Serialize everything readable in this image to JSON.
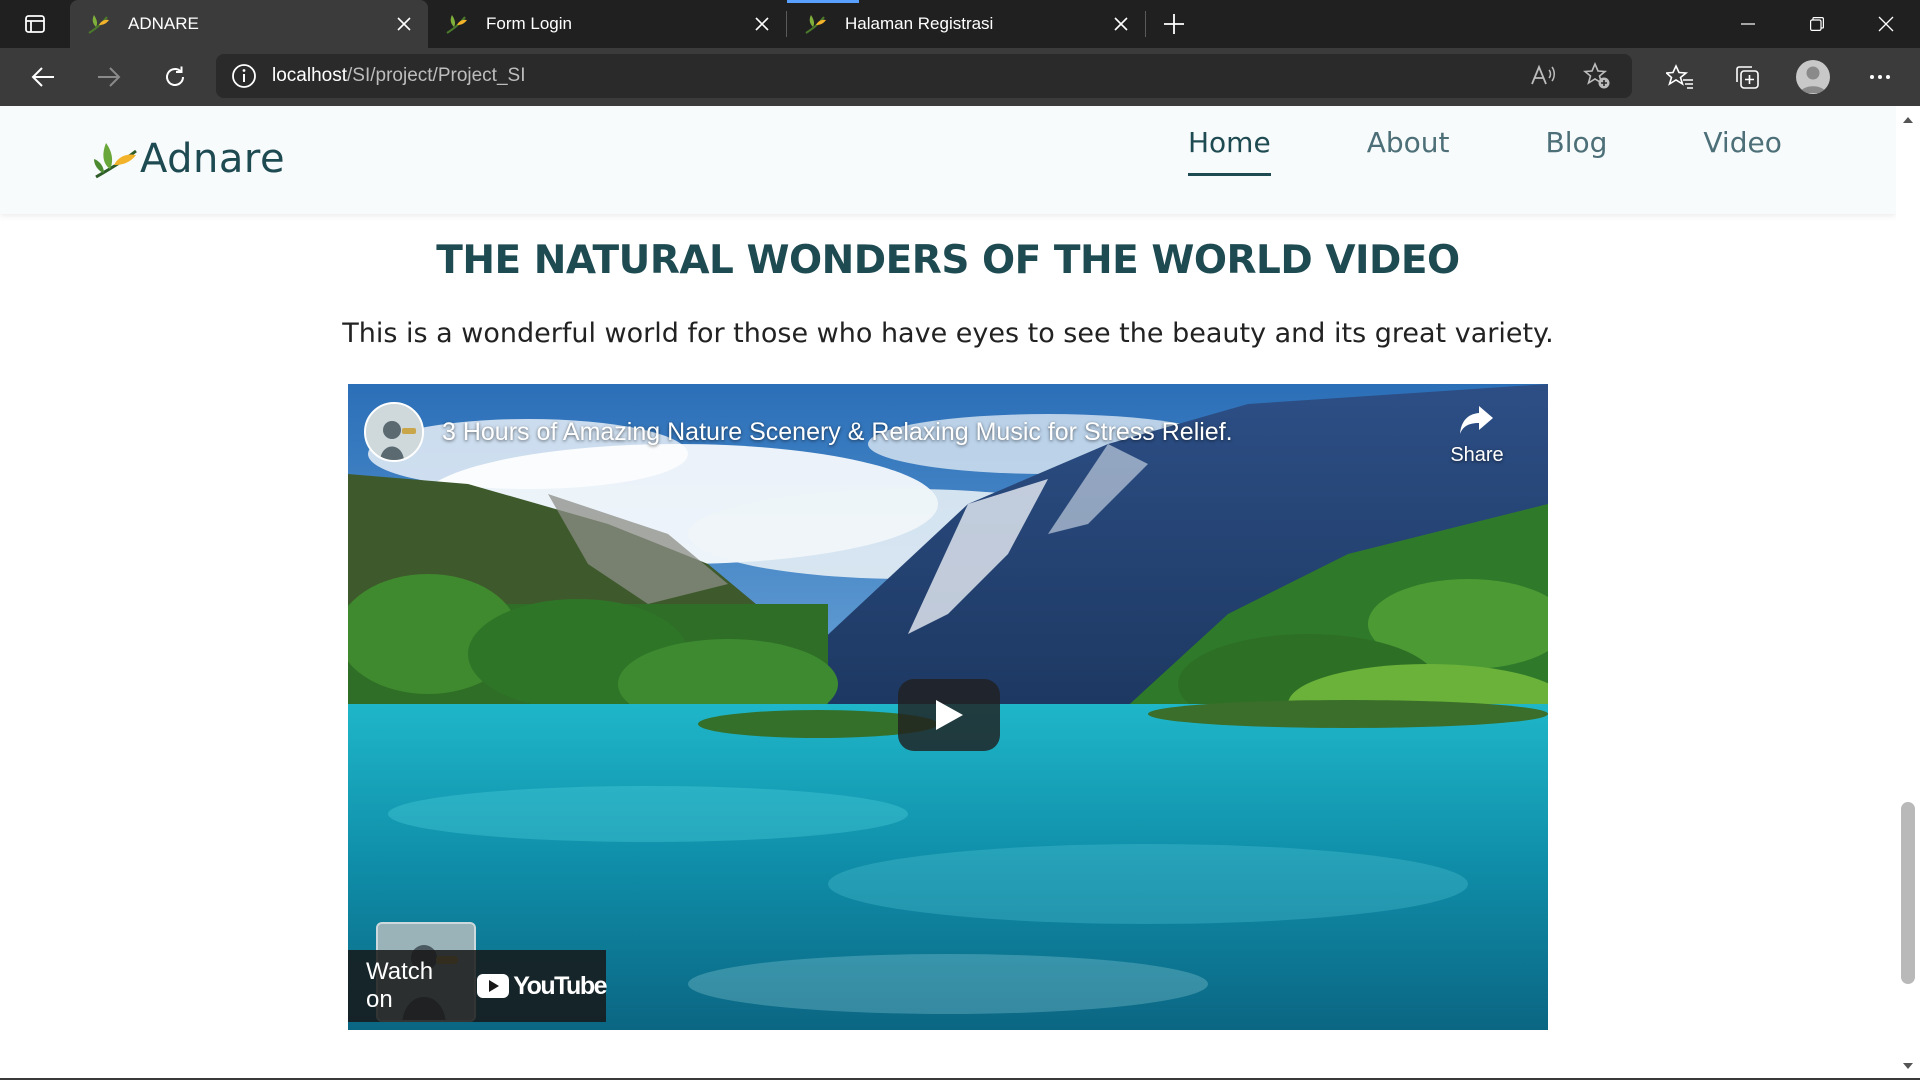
{
  "browser": {
    "tabs": [
      {
        "title": "ADNARE",
        "active": true
      },
      {
        "title": "Form Login",
        "active": false
      },
      {
        "title": "Halaman Registrasi",
        "active": false
      }
    ],
    "url_host": "localhost",
    "url_path": "/SI/project/Project_SI",
    "accent": "#5aa0ff"
  },
  "site": {
    "logo_text": "Adnare",
    "nav": [
      "Home",
      "About",
      "Blog",
      "Video"
    ],
    "active_nav": "Home",
    "brand_color": "#1e4a52"
  },
  "section": {
    "title": "THE NATURAL WONDERS OF THE WORLD VIDEO",
    "subtitle": "This is a wonderful world for those who have eyes to see the beauty and its great variety."
  },
  "video": {
    "title": "3 Hours of Amazing Nature Scenery & Relaxing Music for Stress Relief.",
    "share_label": "Share",
    "watch_on_label": "Watch on",
    "youtube_label": "YouTube"
  }
}
